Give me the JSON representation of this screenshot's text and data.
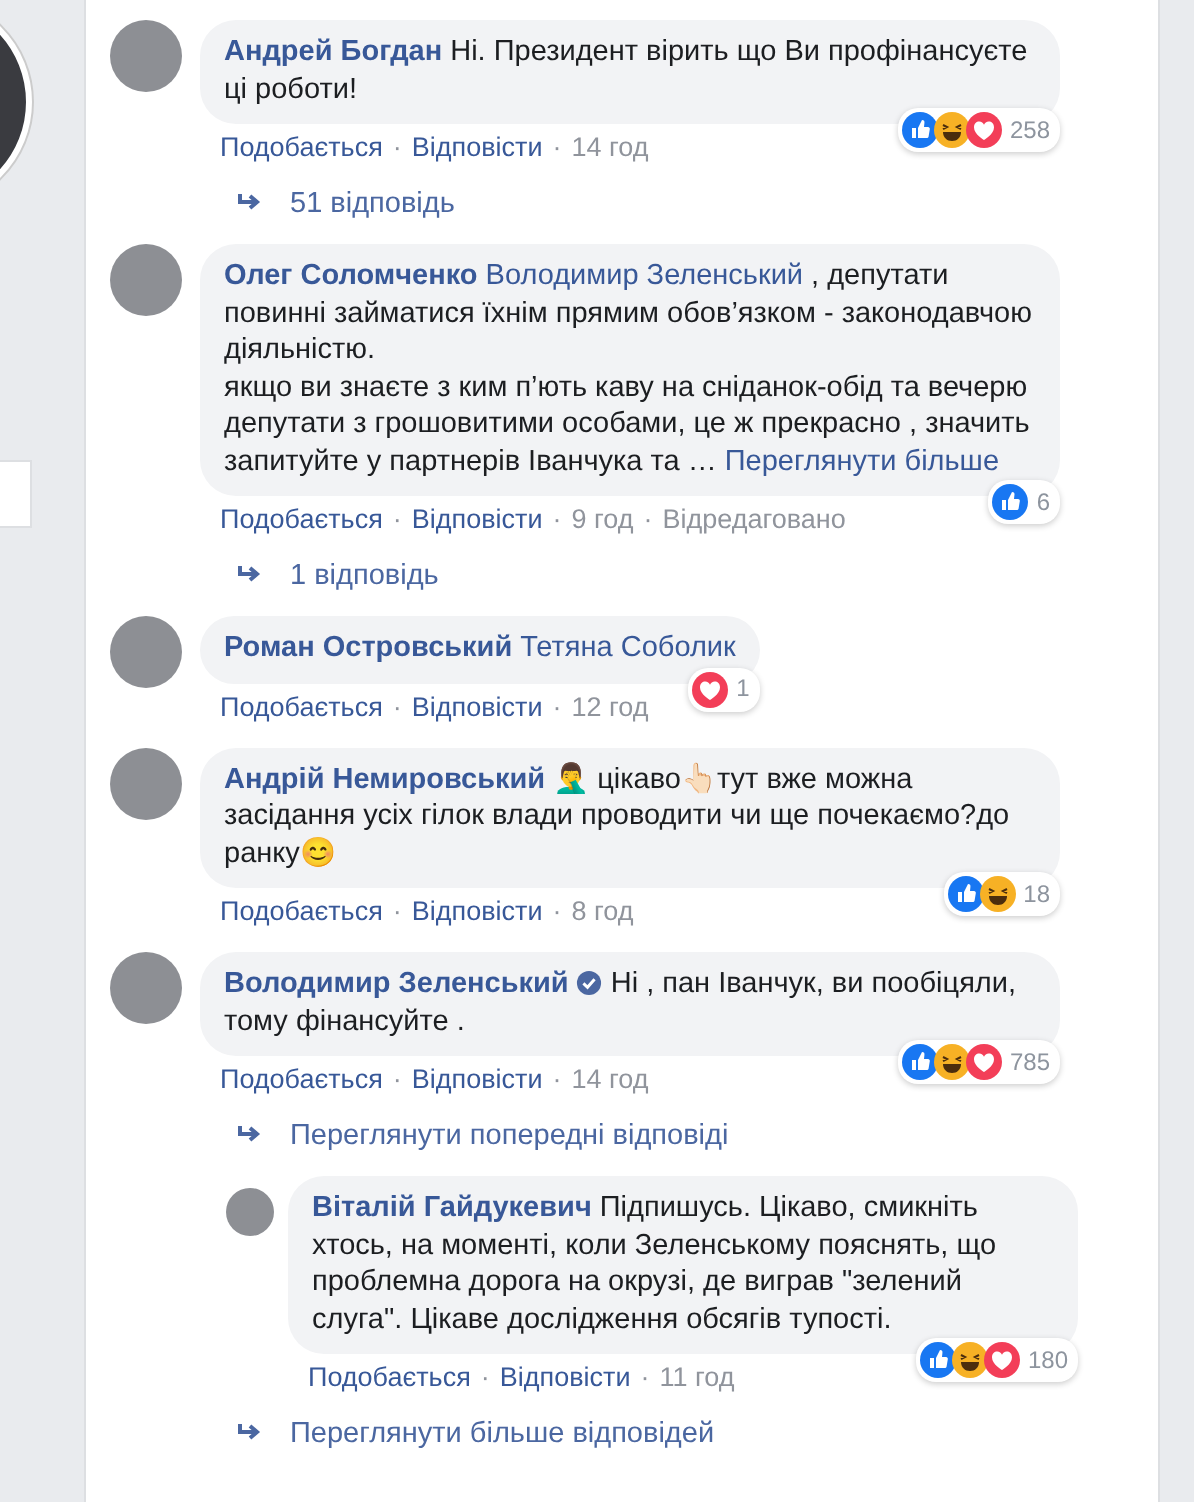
{
  "items": [
    {
      "kind": "comment",
      "author": "Андрей Богдан",
      "verified": false,
      "text": "Ні. Президент вірить що Ви профінансуєте ці роботи!",
      "reactions": [
        {
          "kind": "like"
        },
        {
          "kind": "haha"
        },
        {
          "kind": "love"
        }
      ],
      "reaction_count": "258",
      "actions": [
        {
          "kind": "like",
          "text": "Подобається"
        },
        {
          "kind": "sep",
          "text": "·"
        },
        {
          "kind": "reply",
          "text": "Відповісти"
        },
        {
          "kind": "sep",
          "text": "·"
        },
        {
          "kind": "time",
          "text": "14 год"
        }
      ]
    },
    {
      "kind": "link",
      "text": "51 відповідь"
    },
    {
      "kind": "comment",
      "author": "Олег Соломченко",
      "mention": "Володимир Зеленський",
      "verified": false,
      "text": ", депутати повинні займатися їхнім прямим обов’язком - законодавчою діяльністю.\nякщо ви знаєте з ким п’ють каву на сніданок-обід та вечерю депутати з грошовитими особами, це ж прекрасно , значить запитуйте у партнерів Іванчука та …",
      "see_more": "Переглянути більше",
      "reactions": [
        {
          "kind": "like"
        }
      ],
      "reaction_count": "6",
      "actions": [
        {
          "kind": "like",
          "text": "Подобається"
        },
        {
          "kind": "sep",
          "text": "·"
        },
        {
          "kind": "reply",
          "text": "Відповісти"
        },
        {
          "kind": "sep",
          "text": "·"
        },
        {
          "kind": "time",
          "text": "9 год"
        },
        {
          "kind": "sep",
          "text": "·"
        },
        {
          "kind": "edited",
          "text": "Відредаговано"
        }
      ]
    },
    {
      "kind": "link",
      "text": "1 відповідь"
    },
    {
      "kind": "comment",
      "author": "Роман Островський",
      "mention": "Тетяна Соболик",
      "verified": false,
      "reactions": [
        {
          "kind": "love"
        }
      ],
      "reaction_count": "1",
      "actions": [
        {
          "kind": "like",
          "text": "Подобається"
        },
        {
          "kind": "sep",
          "text": "·"
        },
        {
          "kind": "reply",
          "text": "Відповісти"
        },
        {
          "kind": "sep",
          "text": "·"
        },
        {
          "kind": "time",
          "text": "12 год"
        }
      ]
    },
    {
      "kind": "comment",
      "author": "Андрій Немировський",
      "verified": false,
      "text": "🤦‍♂️ цікаво👆🏻тут вже можна засідання усіх гілок влади проводити чи ще почекаємо?до ранку😊",
      "reactions": [
        {
          "kind": "like"
        },
        {
          "kind": "haha"
        }
      ],
      "reaction_count": "18",
      "actions": [
        {
          "kind": "like",
          "text": "Подобається"
        },
        {
          "kind": "sep",
          "text": "·"
        },
        {
          "kind": "reply",
          "text": "Відповісти"
        },
        {
          "kind": "sep",
          "text": "·"
        },
        {
          "kind": "time",
          "text": "8 год"
        }
      ]
    },
    {
      "kind": "comment",
      "author": "Володимир Зеленський",
      "verified": true,
      "text": "Ні , пан Іванчук, ви пообіцяли, тому фінансуйте .",
      "reactions": [
        {
          "kind": "like"
        },
        {
          "kind": "haha"
        },
        {
          "kind": "love"
        }
      ],
      "reaction_count": "785",
      "actions": [
        {
          "kind": "like",
          "text": "Подобається"
        },
        {
          "kind": "sep",
          "text": "·"
        },
        {
          "kind": "reply",
          "text": "Відповісти"
        },
        {
          "kind": "sep",
          "text": "·"
        },
        {
          "kind": "time",
          "text": "14 год"
        }
      ],
      "replies": [
        {
          "kind": "link",
          "text": "Переглянути попередні відповіді"
        },
        {
          "kind": "comment",
          "author": "Віталій Гайдукевич",
          "verified": false,
          "text": "Підпишусь. Цікаво, смикніть хтось, на моменті, коли Зеленському пояснять, що проблемна дорога на окрузі, де виграв \"зелений слуга\". Цікаве дослідження обсягів тупості.",
          "reactions": [
            {
              "kind": "like"
            },
            {
              "kind": "haha"
            },
            {
              "kind": "love"
            }
          ],
          "reaction_count": "180",
          "actions": [
            {
              "kind": "like",
              "text": "Подобається"
            },
            {
              "kind": "sep",
              "text": "·"
            },
            {
              "kind": "reply",
              "text": "Відповісти"
            },
            {
              "kind": "sep",
              "text": "·"
            },
            {
              "kind": "time",
              "text": "11 год"
            }
          ]
        },
        {
          "kind": "link",
          "text": "Переглянути більше відповідей"
        }
      ]
    }
  ]
}
